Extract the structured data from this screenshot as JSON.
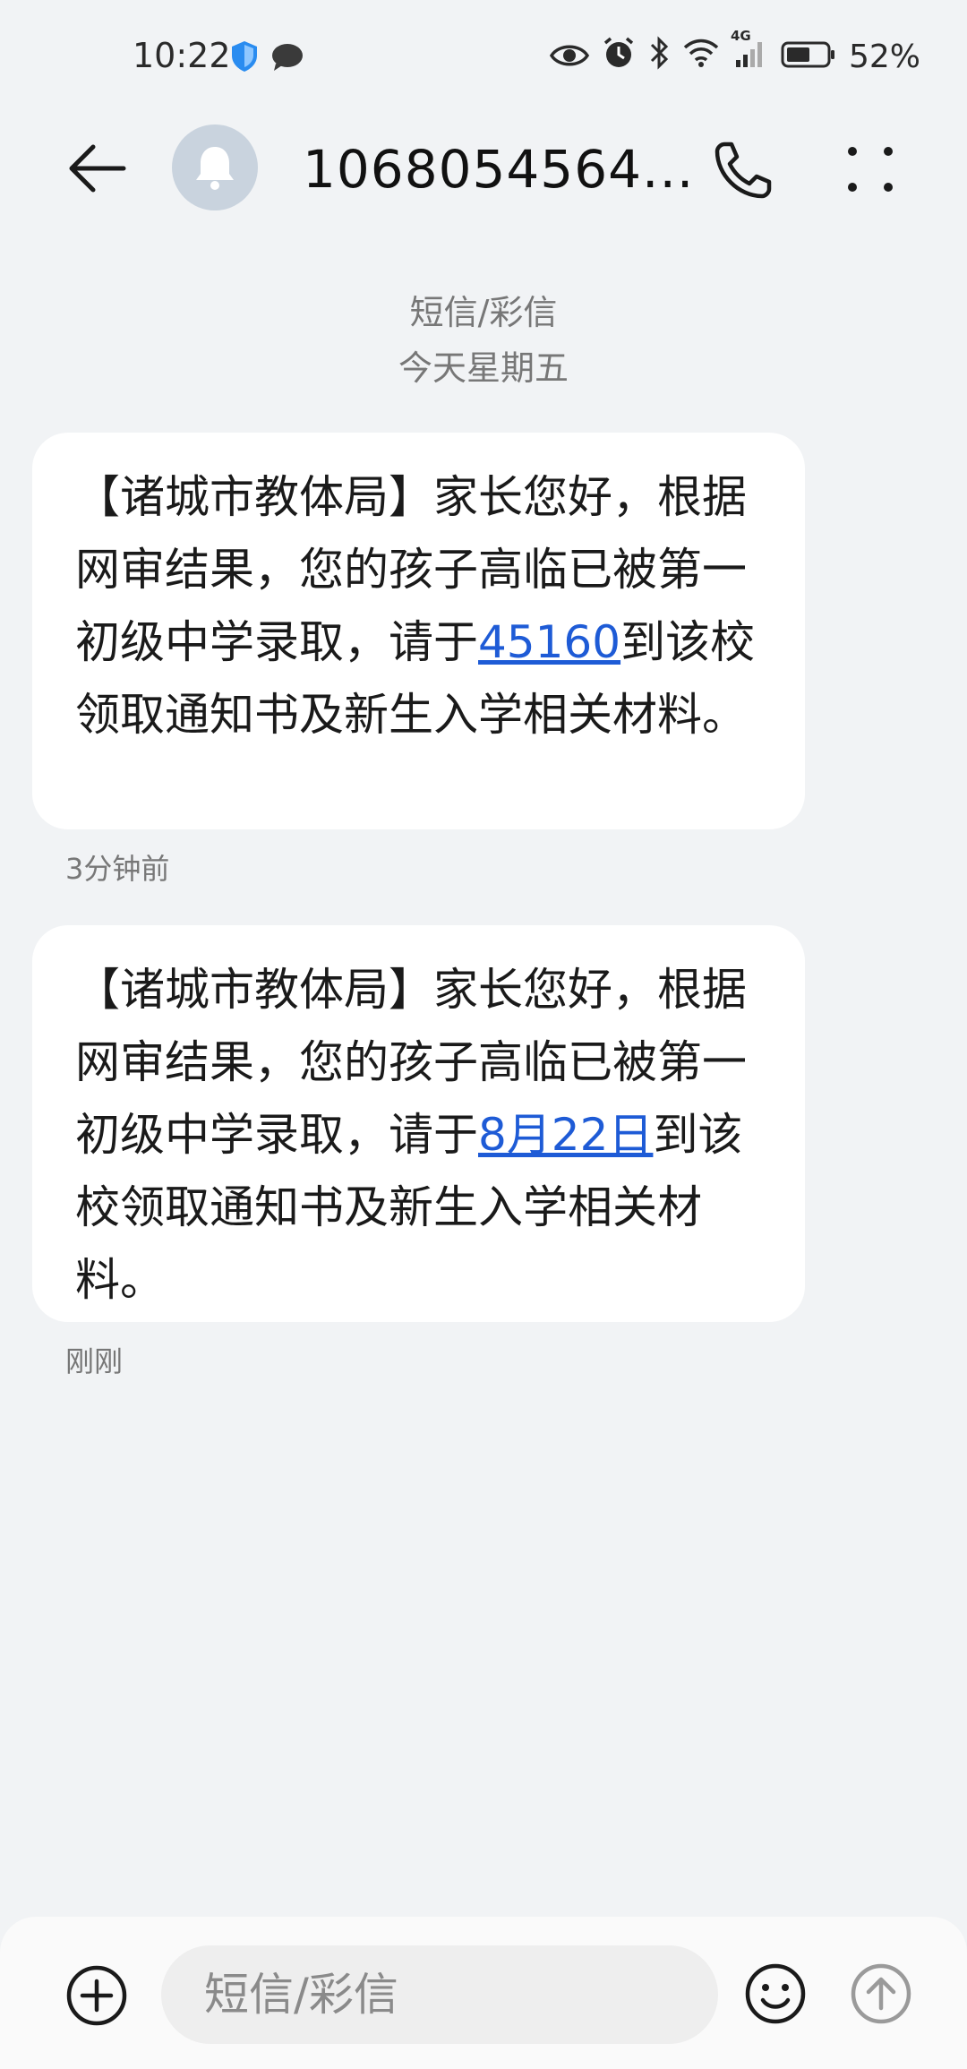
{
  "status_bar": {
    "time": "10:22",
    "battery_percent": "52%",
    "network_label": "4G",
    "icons": [
      "shield-icon",
      "message-icon",
      "eye-icon",
      "alarm-icon",
      "bluetooth-icon",
      "wifi-icon",
      "signal-icon",
      "battery-icon"
    ]
  },
  "header": {
    "contact": "1068054564...",
    "icons": [
      "back-arrow-icon",
      "bell-icon",
      "phone-icon",
      "more-dots-icon"
    ]
  },
  "thread": {
    "type_label": "短信/彩信",
    "date_label": "今天星期五"
  },
  "messages": [
    {
      "parts": [
        {
          "text": "【诸城市教体局】家长您好，根据网审结果，您的孩子高临已被第一初级中学录取，请于"
        },
        {
          "text": "45160",
          "link": true
        },
        {
          "text": "到该校领取通知书及新生入学相关材料。"
        }
      ],
      "time": "3分钟前"
    },
    {
      "parts": [
        {
          "text": "【诸城市教体局】家长您好，根据网审结果，您的孩子高临已被第一初级中学录取，请于"
        },
        {
          "text": "8月22日",
          "link": true
        },
        {
          "text": "到该校领取通知书及新生入学相关材料。"
        }
      ],
      "time": "刚刚"
    }
  ],
  "composer": {
    "placeholder": "短信/彩信",
    "icons": [
      "add-icon",
      "emoji-icon",
      "send-icon"
    ]
  },
  "colors": {
    "background": "#f1f3f5",
    "bubble": "#ffffff",
    "link": "#1e5bd6",
    "avatar": "#c9d3de"
  }
}
